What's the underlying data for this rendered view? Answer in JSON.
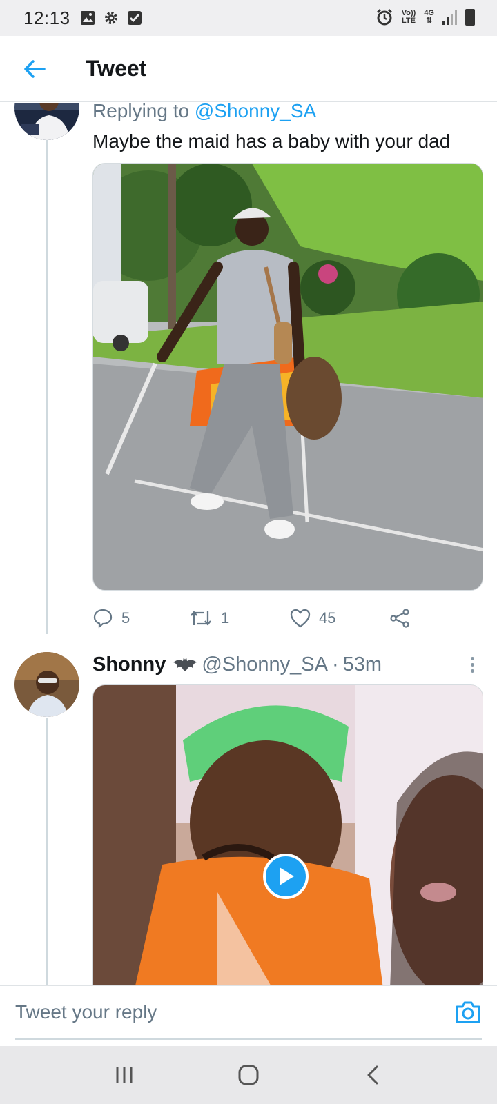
{
  "status_bar": {
    "time": "12:13",
    "left_icons": [
      "gallery-icon",
      "gear-icon",
      "checkbox-icon"
    ],
    "lte_top": "Vo))",
    "lte_bottom": "LTE",
    "network": "4G",
    "right_icons": [
      "alarm-icon",
      "lte-icon",
      "signal-icon",
      "battery-icon"
    ]
  },
  "header": {
    "back_icon": "back-arrow-icon",
    "title": "Tweet"
  },
  "reply_tweet": {
    "replying_prefix": "Replying to",
    "replying_handle": "@Shonny_SA",
    "text": "Maybe the maid has a baby with your dad",
    "media_description_icon": "photo",
    "actions": {
      "replies": "5",
      "retweets": "1",
      "likes": "45"
    }
  },
  "main_tweet": {
    "author_name": "Shonny",
    "author_badge_icon": "bat-icon",
    "handle": "@Shonny_SA",
    "separator": "·",
    "time": "53m",
    "media_type": "video"
  },
  "compose": {
    "placeholder": "Tweet your reply",
    "camera_icon": "camera-icon"
  },
  "nav_bar": {
    "icons": [
      "recent-apps-icon",
      "home-icon",
      "back-icon"
    ]
  },
  "colors": {
    "accent": "#1da1f2",
    "secondary_text": "#657786",
    "primary_text": "#14171a",
    "thread_line": "#cfd9de"
  }
}
